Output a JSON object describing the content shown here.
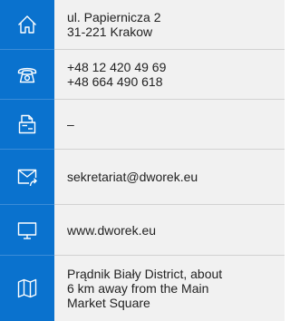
{
  "colors": {
    "accent": "#0a72ce",
    "row_bg": "#f1f1f1",
    "text": "#222222"
  },
  "contacts": [
    {
      "icon": "home-icon",
      "lines": [
        "ul. Papiernicza 2",
        "31-221 Krakow"
      ]
    },
    {
      "icon": "phone-icon",
      "lines": [
        "+48 12 420 49 69",
        "+48 664 490 618"
      ]
    },
    {
      "icon": "fax-icon",
      "lines": [
        "–"
      ]
    },
    {
      "icon": "email-icon",
      "lines": [
        "sekretariat@dworek.eu"
      ]
    },
    {
      "icon": "monitor-icon",
      "lines": [
        "www.dworek.eu"
      ]
    },
    {
      "icon": "map-icon",
      "lines": [
        "Prądnik Biały District, about",
        "6 km away from the Main",
        "Market Square"
      ]
    }
  ]
}
